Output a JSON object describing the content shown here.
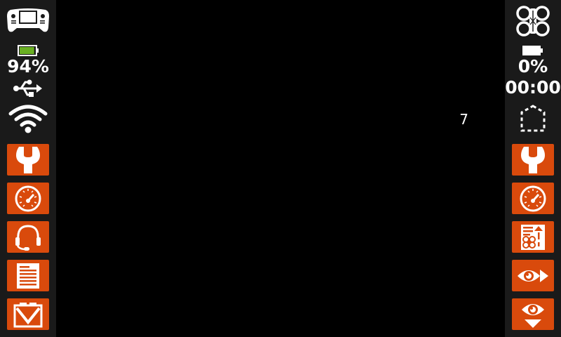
{
  "left_panel": {
    "transmitter_icon": "gamepad-icon",
    "battery_level": 0.94,
    "battery_color": "#6ab023",
    "battery_text": "94%",
    "connection_icon": "usb-icon",
    "wifi_icon": "wifi-icon",
    "buttons": [
      {
        "icon": "wrench-icon"
      },
      {
        "icon": "gauge-icon"
      },
      {
        "icon": "headset-icon"
      },
      {
        "icon": "document-icon"
      },
      {
        "icon": "envelope-icon"
      }
    ]
  },
  "right_panel": {
    "vehicle_icon": "drone-icon",
    "battery_level": 0.0,
    "battery_text": "0%",
    "timer": "00:00",
    "shape_icon": "dashed-hexagon-icon",
    "buttons": [
      {
        "icon": "wrench-icon"
      },
      {
        "icon": "gauge-icon"
      },
      {
        "icon": "drone-checklist-icon"
      },
      {
        "icon": "eye-arrow-icon"
      },
      {
        "icon": "eye-down-icon"
      }
    ]
  },
  "main": {
    "value": "7"
  },
  "colors": {
    "accent": "#d94a0c",
    "sidebar_bg": "#1a1a1a",
    "background": "#000000"
  }
}
